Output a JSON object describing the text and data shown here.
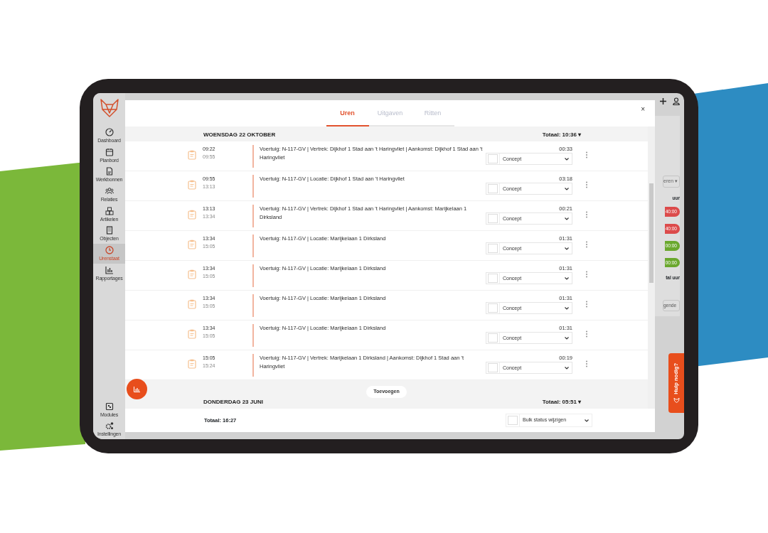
{
  "sidebar": {
    "items": [
      {
        "label": "Dashboard",
        "selected": false
      },
      {
        "label": "Planbord",
        "selected": false
      },
      {
        "label": "Werkbonnen",
        "selected": false
      },
      {
        "label": "Relaties",
        "selected": false
      },
      {
        "label": "Artikelen",
        "selected": false
      },
      {
        "label": "Objecten",
        "selected": false
      },
      {
        "label": "Urenstaat",
        "selected": true
      },
      {
        "label": "Rapportages",
        "selected": false
      }
    ],
    "bottom_items": [
      {
        "label": "Modules",
        "selected": false
      },
      {
        "label": "Instellingen",
        "selected": false
      }
    ]
  },
  "modal": {
    "close": "×",
    "tabs": [
      {
        "label": "Uren",
        "selected": true
      },
      {
        "label": "Uitgaven",
        "selected": false
      },
      {
        "label": "Ritten",
        "selected": false
      }
    ],
    "days": [
      {
        "title": "WOENSDAG 22 OKTOBER",
        "total": "Totaal: 10:36",
        "caret": "▾",
        "entries": [
          {
            "start": "09:22",
            "end": "09:55",
            "description": "Voertuig: N-117-GV | Vertrek: Dijkhof 1 Stad aan 't Haringvliet | Aankomst: Dijkhof 1 Stad aan 't Haringvliet",
            "duration": "00:33",
            "checked": false,
            "status": "Concept"
          },
          {
            "start": "09:55",
            "end": "13:13",
            "description": "Voertuig: N-117-GV | Locatie: Dijkhof 1 Stad aan 't Haringvliet",
            "duration": "03:18",
            "checked": false,
            "status": "Concept"
          },
          {
            "start": "13:13",
            "end": "13:34",
            "description": "Voertuig: N-117-GV | Vertrek: Dijkhof 1 Stad aan 't Haringvliet | Aankomst: Marijkelaan 1 Dirksland",
            "duration": "00:21",
            "checked": false,
            "status": "Concept"
          },
          {
            "start": "13:34",
            "end": "15:05",
            "description": "Voertuig: N-117-GV | Locatie: Marijkelaan 1 Dirksland",
            "duration": "01:31",
            "checked": false,
            "status": "Concept"
          },
          {
            "start": "13:34",
            "end": "15:05",
            "description": "Voertuig: N-117-GV | Locatie: Marijkelaan 1 Dirksland",
            "duration": "01:31",
            "checked": false,
            "status": "Concept"
          },
          {
            "start": "13:34",
            "end": "15:05",
            "description": "Voertuig: N-117-GV | Locatie: Marijkelaan 1 Dirksland",
            "duration": "01:31",
            "checked": false,
            "status": "Concept"
          },
          {
            "start": "13:34",
            "end": "15:05",
            "description": "Voertuig: N-117-GV | Locatie: Marijkelaan 1 Dirksland",
            "duration": "01:31",
            "checked": false,
            "status": "Concept"
          },
          {
            "start": "15:05",
            "end": "15:24",
            "description": "Voertuig: N-117-GV | Vertrek: Marijkelaan 1 Dirksland | Aankomst: Dijkhof 1 Stad aan 't Haringvliet",
            "duration": "00:19",
            "checked": false,
            "status": "Concept"
          }
        ]
      },
      {
        "title": "DONDERDAG 23 JUNI",
        "total": "Totaal: 05:51",
        "caret": "▾"
      }
    ],
    "add_button": "Toevoegen",
    "footer_total": "Totaal: 16:27",
    "bulk": {
      "checked": false,
      "label": "Bulk status wijzigen"
    }
  },
  "background": {
    "filter_label": "eren ▾",
    "column_header": "uur",
    "badges": [
      {
        "text": "40:00",
        "color": "#dc4b4b"
      },
      {
        "text": "40:00",
        "color": "#dc4b4b"
      },
      {
        "text": "00:00",
        "color": "#6aa82e"
      },
      {
        "text": "00:00",
        "color": "#6aa82e"
      }
    ],
    "total_label": "tal uur",
    "button_label": "gende"
  },
  "help_tab": "Hulp nodig?"
}
